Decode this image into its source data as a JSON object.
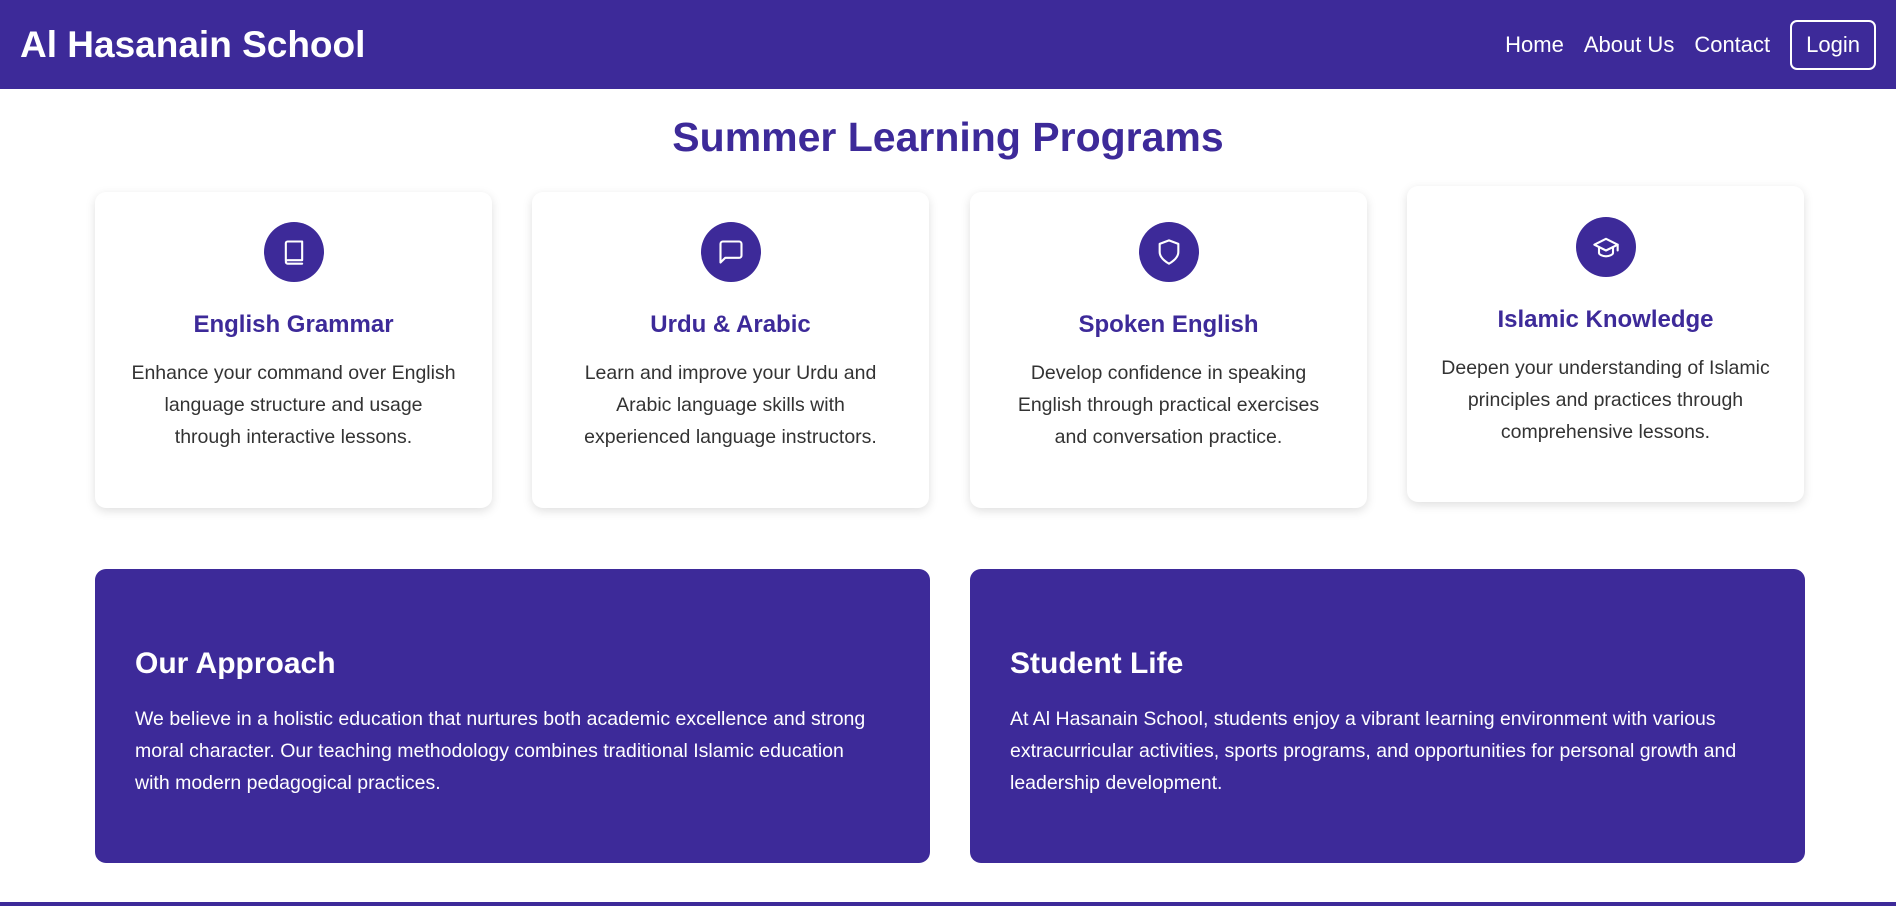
{
  "header": {
    "brand": "Al Hasanain School",
    "nav": [
      "Home",
      "About Us",
      "Contact"
    ],
    "login_label": "Login"
  },
  "programs": {
    "title": "Summer Learning Programs",
    "cards": [
      {
        "icon": "book-icon",
        "title": "English Grammar",
        "lines": [
          "Enhance your command over English",
          "language structure and usage",
          "through interactive lessons."
        ]
      },
      {
        "icon": "message-icon",
        "title": "Urdu & Arabic",
        "lines": [
          "Learn and improve your Urdu and",
          "Arabic language skills with",
          "experienced language instructors."
        ]
      },
      {
        "icon": "shield-icon",
        "title": "Spoken English",
        "lines": [
          "Develop confidence in speaking",
          "English through practical exercises",
          "and conversation practice."
        ]
      },
      {
        "icon": "graduation-cap-icon",
        "title": "Islamic Knowledge",
        "lines": [
          "Deepen your understanding of Islamic",
          "principles and practices through",
          "comprehensive lessons."
        ]
      }
    ]
  },
  "approach": {
    "title": "Our Approach",
    "lines": [
      "We believe in a holistic education that nurtures both academic excellence and strong",
      "moral character. Our teaching methodology combines traditional Islamic education",
      "with modern pedagogical practices."
    ]
  },
  "student_life": {
    "title": "Student Life",
    "lines": [
      "At Al Hasanain School, students enjoy a vibrant learning environment with various",
      "extracurricular activities, sports programs, and opportunities for personal growth and",
      "leadership development."
    ]
  },
  "colors": {
    "primary": "#3d2a99",
    "text": "#333333",
    "background": "#ffffff"
  }
}
